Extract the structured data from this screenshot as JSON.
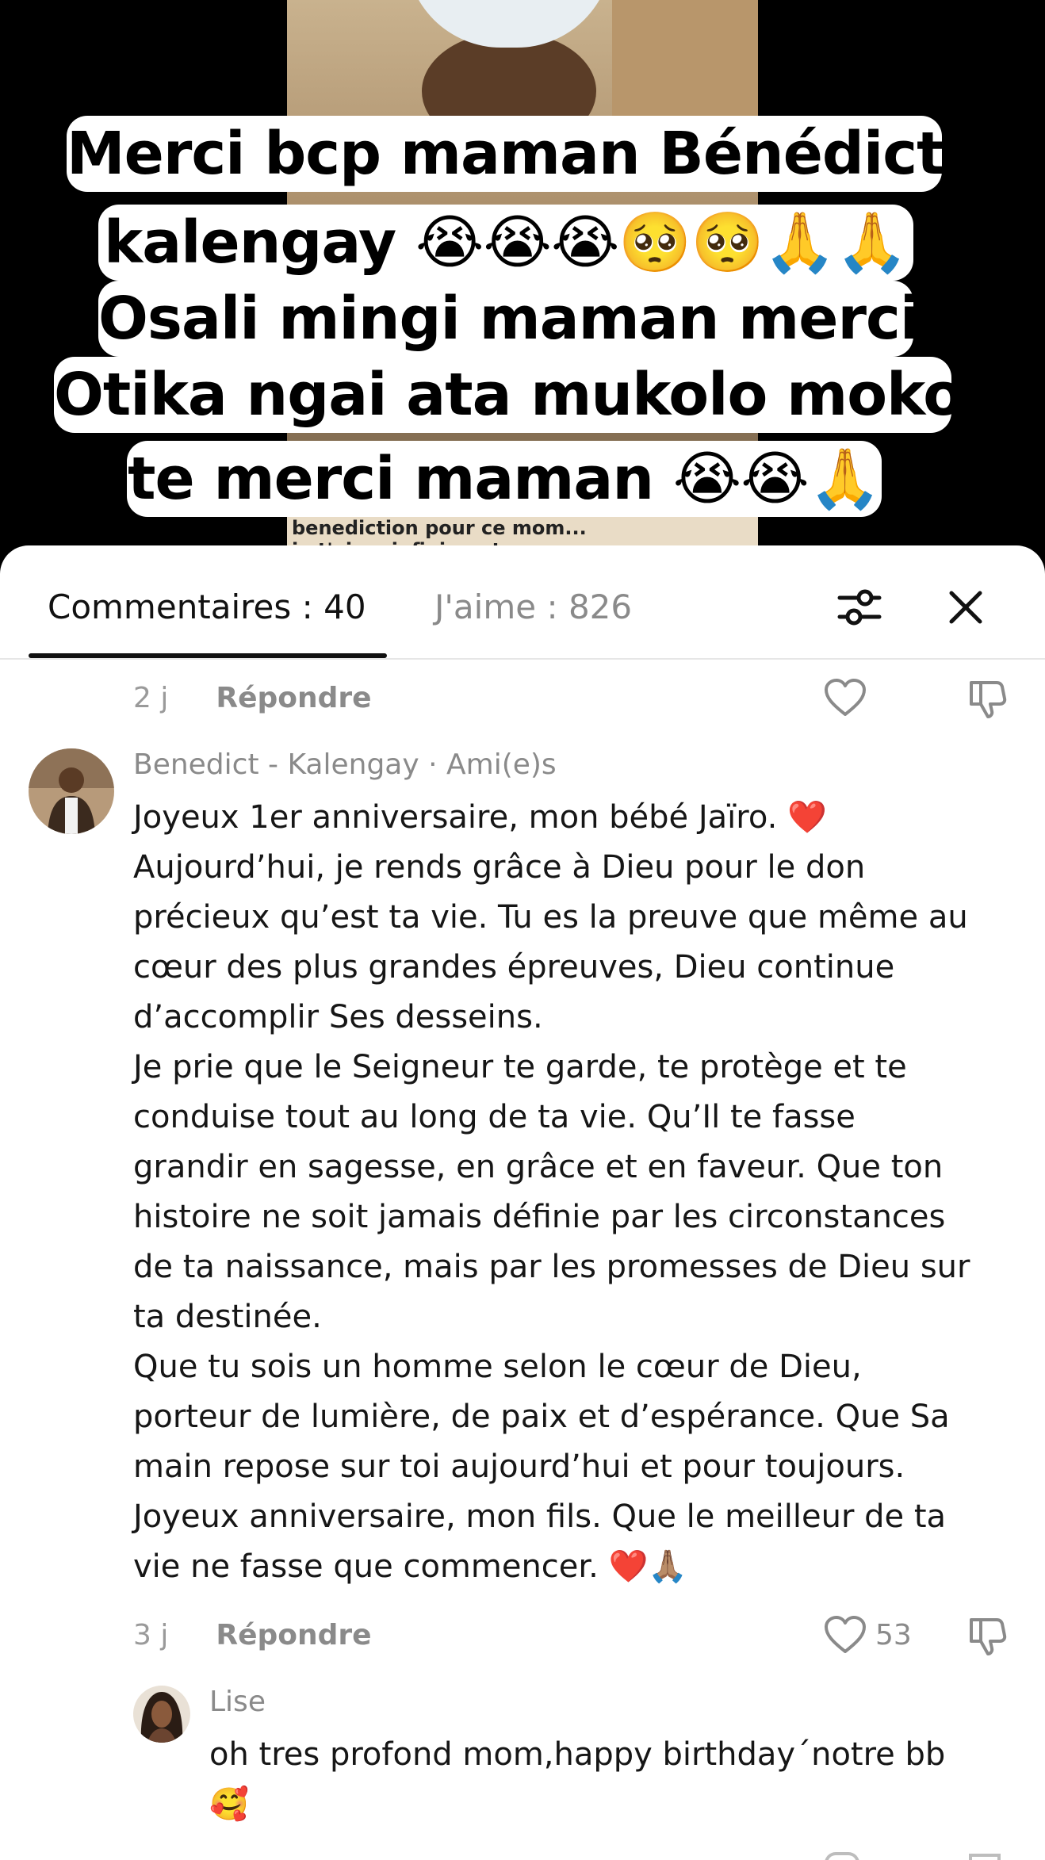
{
  "video": {
    "ticker_line_1": "benediction pour ce mom...",
    "ticker_line_2": "je t'aime infiniment"
  },
  "caption": {
    "lines": [
      "Merci bcp maman Bénédict",
      "kalengay 😭😭😭🥺🥺🙏🙏",
      "Osali mingi maman merci",
      "Otika ngai ata mukolo moko",
      "te merci maman 😭😭🙏"
    ]
  },
  "tabs": {
    "comments": "Commentaires : 40",
    "likes": "J'aime : 826"
  },
  "icons": {
    "filter": "sliders-icon",
    "close": "close-icon",
    "like": "heart-outline-icon",
    "dislike": "thumbs-down-icon"
  },
  "previous_comment": {
    "time": "2 j",
    "reply": "Répondre"
  },
  "comment": {
    "author": "Benedict - Kalengay · Ami(e)s",
    "text": "Joyeux 1er anniversaire, mon bébé Jaïro. ❤️\nAujourd’hui, je rends grâce à Dieu pour le don\nprécieux qu’est ta vie. Tu es la preuve que même au\ncœur des plus grandes épreuves, Dieu continue\nd’accomplir Ses desseins.\nJe prie que le Seigneur te garde, te protège et te\nconduise tout au long de ta vie. Qu’Il te fasse\ngrandir en sagesse, en grâce et en faveur. Que ton\nhistoire ne soit jamais définie par les circonstances\nde ta naissance, mais par les promesses de Dieu sur\nta destinée.\nQue tu sois un homme selon le cœur de Dieu,\nporteur de lumière, de paix et d’espérance. Que Sa\nmain repose sur toi aujourd’hui et pour toujours.\nJoyeux anniversaire, mon fils. Que le meilleur de ta\nvie ne fasse que commencer. ❤️🙏🏽",
    "time": "3 j",
    "reply": "Répondre",
    "likes": "53"
  },
  "reply": {
    "author": "Lise",
    "text": "oh tres profond mom,happy birthday´notre bb\n🥰"
  }
}
